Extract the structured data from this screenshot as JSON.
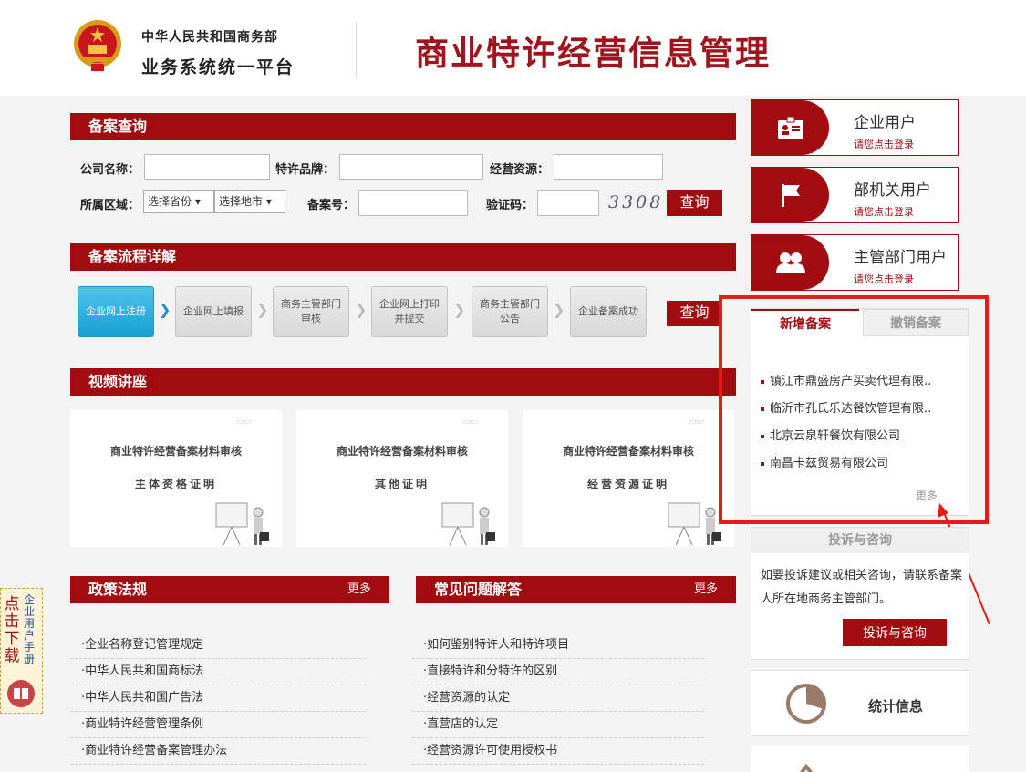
{
  "header": {
    "org": "中华人民共和国商务部",
    "platform": "业务系统统一平台",
    "title": "商业特许经营信息管理"
  },
  "query": {
    "section_title": "备案查询",
    "company_label": "公司名称：",
    "brand_label": "特许品牌：",
    "resource_label": "经营资源：",
    "region_label": "所属区域：",
    "province_select": "选择省份",
    "city_select": "选择地市",
    "record_label": "备案号：",
    "captcha_label": "验证码：",
    "captcha_text": "3308",
    "search_button": "查询"
  },
  "process": {
    "section_title": "备案流程详解",
    "steps": [
      "企业网上注册",
      "企业网上填报",
      "商务主管部门审核",
      "企业网上打印并提交",
      "商务主管部门公告",
      "企业备案成功"
    ],
    "search_button": "查询"
  },
  "video": {
    "section_title": "视频讲座",
    "items": [
      {
        "title": "商业特许经营备案材料审核",
        "subtitle": "主体资格证明"
      },
      {
        "title": "商业特许经营备案材料审核",
        "subtitle": "其他证明"
      },
      {
        "title": "商业特许经营备案材料审核",
        "subtitle": "经营资源证明"
      }
    ]
  },
  "policy": {
    "section_title": "政策法规",
    "more": "更多",
    "items": [
      "·企业名称登记管理规定",
      "·中华人民共和国商标法",
      "·中华人民共和国广告法",
      "·商业特许经营管理条例",
      "·商业特许经营备案管理办法"
    ]
  },
  "faq": {
    "section_title": "常见问题解答",
    "more": "更多",
    "items": [
      "·如何鉴别特许人和特许项目",
      "·直接特许和分特许的区别",
      "·经营资源的认定",
      "·直营店的认定",
      "·经营资源许可使用授权书"
    ]
  },
  "users": [
    {
      "name": "企业用户",
      "sub": "请您点击登录",
      "icon": "id-card-icon"
    },
    {
      "name": "部机关用户",
      "sub": "请您点击登录",
      "icon": "flag-icon"
    },
    {
      "name": "主管部门用户",
      "sub": "请您点击登录",
      "icon": "users-icon"
    }
  ],
  "records": {
    "tab_new": "新增备案",
    "tab_cancel": "撤销备案",
    "items": [
      "镇江市鼎盛房产买卖代理有限..",
      "临沂市孔氏乐达餐饮管理有限..",
      "北京云泉轩餐饮有限公司",
      "南昌卡兹贸易有限公司"
    ],
    "more": "更多"
  },
  "consult": {
    "title": "投诉与咨询",
    "text": "如要投诉建议或相关咨询，请联系备案人所在地商务主管部门。",
    "button": "投诉与咨询"
  },
  "stats": {
    "label": "统计信息"
  },
  "manual": {
    "download": "点击下载",
    "name": "企业用户手册"
  },
  "colors": {
    "brand_red": "#a10c10",
    "highlight_red": "#e81b1b",
    "step_active": "#17a0d2"
  }
}
